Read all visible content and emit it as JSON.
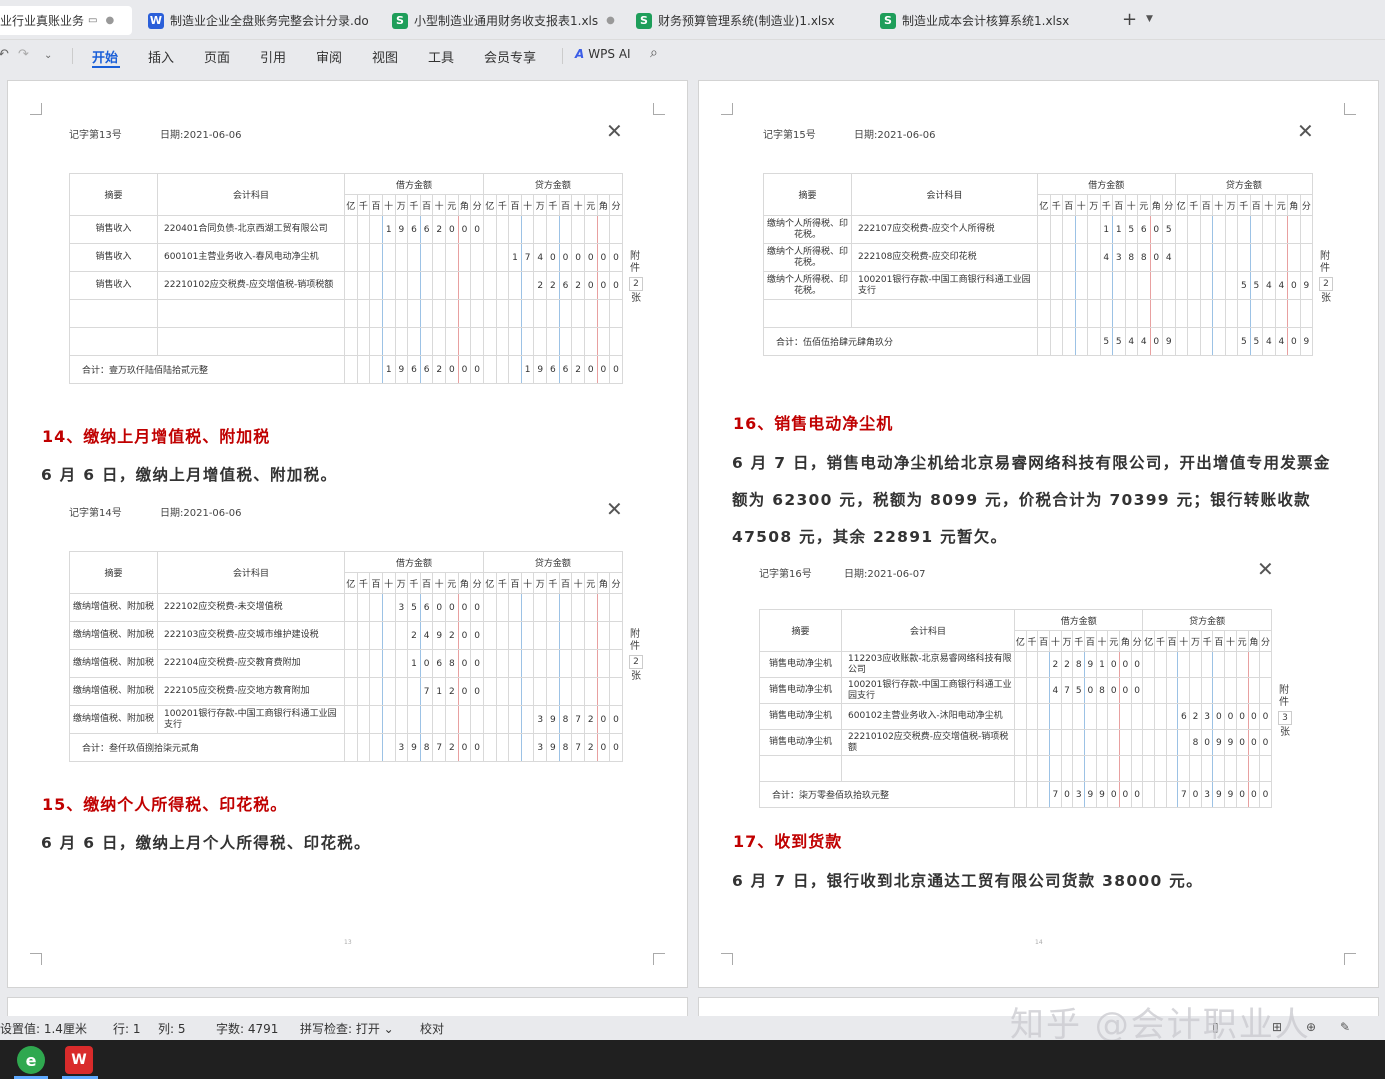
{
  "tabs": [
    {
      "label": "业行业真账业务",
      "icon": "",
      "active": true
    },
    {
      "label": "制造业企业全盘账务完整会计分录.do",
      "icon": "W"
    },
    {
      "label": "小型制造业通用财务收支报表1.xls",
      "icon": "S"
    },
    {
      "label": "财务预算管理系统(制造业)1.xlsx",
      "icon": "S"
    },
    {
      "label": "制造业成本会计核算系统1.xlsx",
      "icon": "S"
    }
  ],
  "ribbon": {
    "items": [
      "开始",
      "插入",
      "页面",
      "引用",
      "审阅",
      "视图",
      "工具",
      "会员专享"
    ],
    "wps_ai": "WPS AI"
  },
  "table_headers": {
    "abstract": "摘要",
    "account": "会计科目",
    "debit": "借方金额",
    "credit": "贷方金额",
    "units": [
      "亿",
      "千",
      "百",
      "十",
      "万",
      "千",
      "百",
      "十",
      "元",
      "角",
      "分"
    ],
    "attach_pre": "附件",
    "attach_post": "张"
  },
  "left_page": {
    "v13": {
      "no": "记字第13号",
      "date": "日期:2021-06-06",
      "attach": "2",
      "rows": [
        {
          "abs": "销售收入",
          "acct": "220401合同负债-北京西湖工贸有限公司",
          "debit": "196620 0",
          "credit": ""
        },
        {
          "abs": "销售收入",
          "acct": "600101主营业务收入-春风电动净尘机",
          "debit": "",
          "credit": "174000 00"
        },
        {
          "abs": "销售收入",
          "acct": "22210102应交税费-应交增值税-销项税额",
          "debit": "",
          "credit": "22620 0"
        }
      ],
      "total": "合计：壹万玖仟陆佰陆拾贰元整",
      "total_debit": "19662 00",
      "total_credit": "19662 00"
    },
    "h14": "14、缴纳上月增值税、附加税",
    "t14": "6 月 6 日，缴纳上月增值税、附加税。",
    "v14": {
      "no": "记字第14号",
      "date": "日期:2021-06-06",
      "attach": "2",
      "rows": [
        {
          "abs": "缴纳增值税、附加税",
          "acct": "222102应交税费-未交增值税",
          "debit": "35600 0",
          "credit": ""
        },
        {
          "abs": "缴纳增值税、附加税",
          "acct": "222103应交税费-应交城市维护建设税",
          "debit": "2492 0",
          "credit": ""
        },
        {
          "abs": "缴纳增值税、附加税",
          "acct": "222104应交税费-应交教育费附加",
          "debit": "1068 0",
          "credit": ""
        },
        {
          "abs": "缴纳增值税、附加税",
          "acct": "222105应交税费-应交地方教育附加",
          "debit": "712 0",
          "credit": ""
        },
        {
          "abs": "缴纳增值税、附加税",
          "acct": "100201银行存款-中国工商银行科通工业园支行",
          "debit": "",
          "credit": "39872 0"
        }
      ],
      "total": "合计：叁仟玖佰捌拾柒元贰角",
      "total_debit": "39872 0",
      "total_credit": "39872 0"
    },
    "h15": "15、缴纳个人所得税、印花税。",
    "t15": "6 月 6 日，缴纳上月个人所得税、印花税。",
    "pgnum": "13"
  },
  "right_page": {
    "v15": {
      "no": "记字第15号",
      "date": "日期:2021-06-06",
      "attach": "2",
      "rows": [
        {
          "abs": "缴纳个人所得税、印花税。",
          "acct": "222107应交税费-应交个人所得税",
          "debit": "1156 5",
          "credit": ""
        },
        {
          "abs": "缴纳个人所得税、印花税。",
          "acct": "222108应交税费-应交印花税",
          "debit": "4388 4",
          "credit": ""
        },
        {
          "abs": "缴纳个人所得税、印花税。",
          "acct": "100201银行存款-中国工商银行科通工业园支行",
          "debit": "",
          "credit": "5544 9"
        }
      ],
      "total": "合计：伍佰伍拾肆元肆角玖分",
      "total_debit": "5544 9",
      "total_credit": "5544 9"
    },
    "h16": "16、销售电动净尘机",
    "t16": "6 月 7 日，销售电动净尘机给北京易睿网络科技有限公司，开出增值专用发票金额为 62300 元，税额为 8099 元，价税合计为 70399 元；银行转账收款 47508 元，其余 22891 元暂欠。",
    "v16": {
      "no": "记字第16号",
      "date": "日期:2021-06-07",
      "attach": "3",
      "rows": [
        {
          "abs": "销售电动净尘机",
          "acct": "112203应收账款-北京易睿网络科技有限公司",
          "debit": "228910 0",
          "credit": ""
        },
        {
          "abs": "销售电动净尘机",
          "acct": "100201银行存款-中国工商银行科通工业园支行",
          "debit": "475080 0",
          "credit": ""
        },
        {
          "abs": "销售电动净尘机",
          "acct": "600102主营业务收入-沐阳电动净尘机",
          "debit": "",
          "credit": "623000 0"
        },
        {
          "abs": "销售电动净尘机",
          "acct": "22210102应交税费-应交增值税-销项税额",
          "debit": "",
          "credit": "80990 0"
        }
      ],
      "total": "合计：柒万零叁佰玖拾玖元整",
      "total_debit": "703990 0",
      "total_credit": "703990 0"
    },
    "h17": "17、收到货款",
    "t17": "6 月 7 日，银行收到北京通达工贸有限公司货款 38000 元。",
    "pgnum": "14"
  },
  "status": {
    "setting": "设置值: 1.4厘米",
    "row": "行: 1",
    "col": "列: 5",
    "words": "字数: 4791",
    "spell": "拼写检查: 打开 ⌄",
    "proof": "校对"
  },
  "watermark": "知乎 @会计职业人",
  "icons": [
    "monitor-icon",
    "undo-icon",
    "redo-icon",
    "chevron-down-icon",
    "search-icon",
    "close-icon",
    "plus-icon",
    "browser-taskbar-icon",
    "wps-taskbar-icon"
  ]
}
